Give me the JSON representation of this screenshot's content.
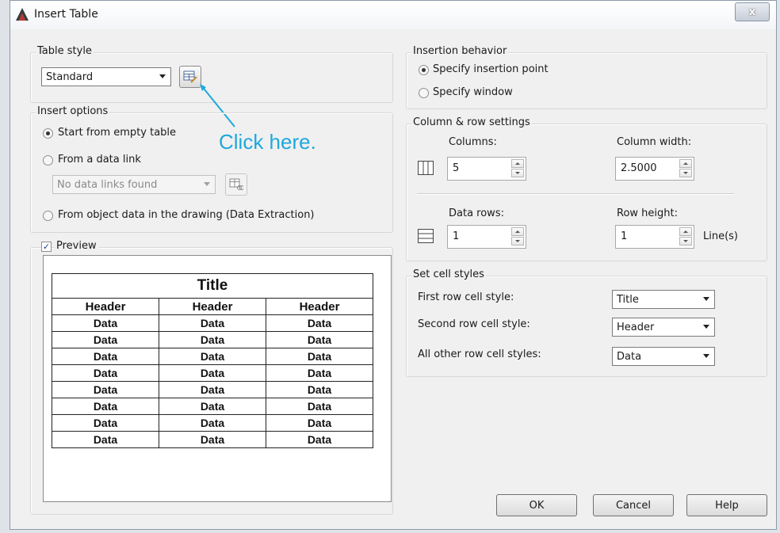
{
  "window": {
    "title": "Insert Table",
    "close_label": "x",
    "annotation": "Click here."
  },
  "table_style": {
    "label": "Table style",
    "value": "Standard",
    "launch_icon": "table-style-dialog-icon"
  },
  "insert_options": {
    "label": "Insert options",
    "start_empty": "Start from empty table",
    "from_data_link": "From a data link",
    "data_link_value": "No data links found",
    "from_object_data": "From object data in the drawing (Data Extraction)"
  },
  "preview": {
    "label": "Preview",
    "checked": true,
    "table": {
      "title": "Title",
      "headers": [
        "Header",
        "Header",
        "Header"
      ],
      "rows": [
        [
          "Data",
          "Data",
          "Data"
        ],
        [
          "Data",
          "Data",
          "Data"
        ],
        [
          "Data",
          "Data",
          "Data"
        ],
        [
          "Data",
          "Data",
          "Data"
        ],
        [
          "Data",
          "Data",
          "Data"
        ],
        [
          "Data",
          "Data",
          "Data"
        ],
        [
          "Data",
          "Data",
          "Data"
        ],
        [
          "Data",
          "Data",
          "Data"
        ]
      ]
    }
  },
  "insertion_behavior": {
    "label": "Insertion behavior",
    "point": "Specify insertion point",
    "window": "Specify window",
    "selected": "point"
  },
  "column_row": {
    "label": "Column & row settings",
    "columns_label": "Columns:",
    "columns_value": "5",
    "col_width_label": "Column width:",
    "col_width_value": "2.5000",
    "data_rows_label": "Data rows:",
    "data_rows_value": "1",
    "row_height_label": "Row height:",
    "row_height_value": "1",
    "row_height_unit": "Line(s)"
  },
  "cell_styles": {
    "label": "Set cell styles",
    "first_row_label": "First row cell style:",
    "first_row_value": "Title",
    "second_row_label": "Second row cell style:",
    "second_row_value": "Header",
    "other_rows_label": "All other row cell styles:",
    "other_rows_value": "Data"
  },
  "buttons": {
    "ok": "OK",
    "cancel": "Cancel",
    "help": "Help"
  },
  "colors": {
    "annotation": "#1fa8dc",
    "dialog_bg": "#f0f0f0"
  }
}
